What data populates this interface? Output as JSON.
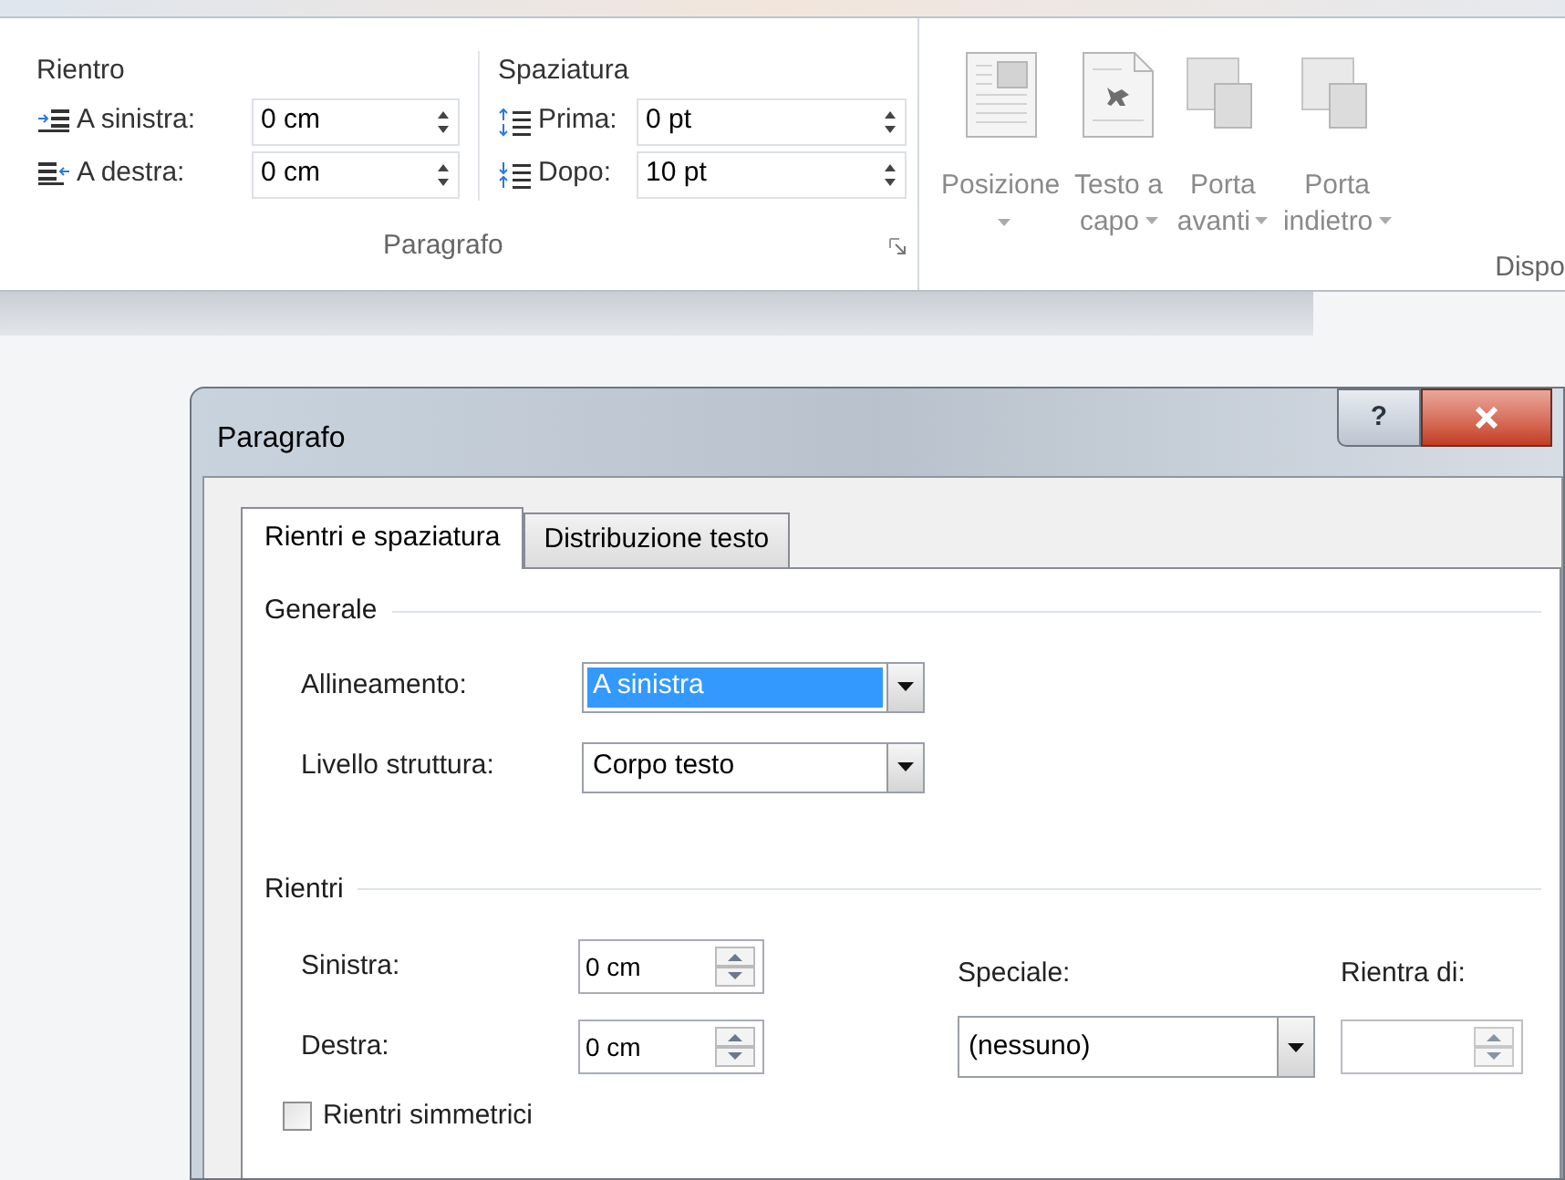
{
  "ribbon": {
    "groups": [
      {
        "label": "Paragrafo",
        "sections": [
          {
            "title": "Rientro",
            "fields": [
              {
                "kind": "indent_left",
                "label": "A sinistra:",
                "value": "0 cm"
              },
              {
                "kind": "indent_right",
                "label": "A destra:",
                "value": "0 cm"
              }
            ]
          },
          {
            "title": "Spaziatura",
            "fields": [
              {
                "kind": "space_before",
                "label": "Prima:",
                "value": "0 pt"
              },
              {
                "kind": "space_after",
                "label": "Dopo:",
                "value": "10 pt"
              }
            ]
          }
        ]
      }
    ],
    "arrange_buttons": [
      {
        "kind": "position",
        "lines": [
          "Posizione"
        ],
        "disabled": true
      },
      {
        "kind": "wrap",
        "lines": [
          "Testo a",
          "capo"
        ],
        "disabled": true
      },
      {
        "kind": "forward",
        "lines": [
          "Porta",
          "avanti"
        ],
        "disabled": true
      },
      {
        "kind": "backward",
        "lines": [
          "Porta",
          "indietro"
        ],
        "disabled": true
      }
    ],
    "arrange_group_label": "Dispo"
  },
  "dialog": {
    "title": "Paragrafo",
    "help_label": "?",
    "tabs": [
      {
        "label": "Rientri e spaziatura",
        "selected": true
      },
      {
        "label": "Distribuzione testo",
        "selected": false
      }
    ],
    "general": {
      "title": "Generale",
      "rows": [
        {
          "label": "Allineamento:",
          "value": "A sinistra",
          "focused": true
        },
        {
          "label": "Livello struttura:",
          "value": "Corpo testo",
          "focused": false
        }
      ]
    },
    "indents": {
      "title": "Rientri",
      "left": {
        "label": "Sinistra:",
        "value": "0 cm"
      },
      "right": {
        "label": "Destra:",
        "value": "0 cm"
      },
      "special": {
        "label": "Speciale:",
        "value": "(nessuno)"
      },
      "by": {
        "label": "Rientra di:"
      },
      "mirror": {
        "label": "Rientri simmetrici",
        "checked": false
      }
    }
  }
}
